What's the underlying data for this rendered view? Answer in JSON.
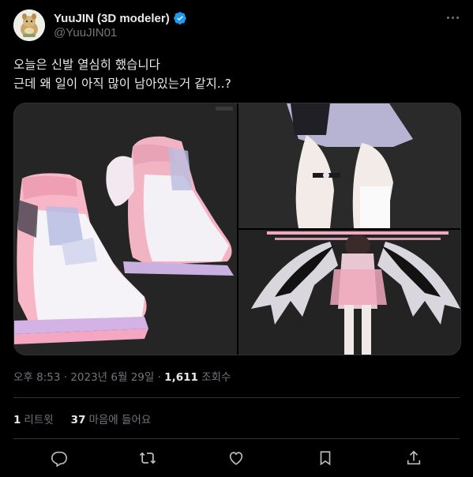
{
  "author": {
    "display_name": "YuuJIN (3D modeler)",
    "handle": "@YuuJIN01",
    "verified": true,
    "avatar_icon": "avatar-image"
  },
  "tweet": {
    "lines": [
      "오늘은 신발 열심히 했습니다",
      "근데 왜 일이 아직 많이 남아있는거 같지..?"
    ]
  },
  "media": {
    "images": [
      {
        "label": "pink-white-boots-render"
      },
      {
        "label": "legs-skirt-render"
      },
      {
        "label": "winged-character-render"
      }
    ]
  },
  "meta": {
    "time": "오후 8:53",
    "separator": " · ",
    "date": "2023년 6월 29일",
    "views_count": "1,611",
    "views_label": "조회수"
  },
  "stats": {
    "retweets_count": "1",
    "retweets_label": "리트윗",
    "likes_count": "37",
    "likes_label": "마음에 들어요"
  },
  "actions": [
    "reply-icon",
    "retweet-icon",
    "like-icon",
    "bookmark-icon",
    "share-icon"
  ],
  "colors": {
    "background": "#000000",
    "text": "#e7e9ea",
    "muted": "#71767b",
    "border": "#2f3336",
    "verified": "#1d9bf0"
  }
}
